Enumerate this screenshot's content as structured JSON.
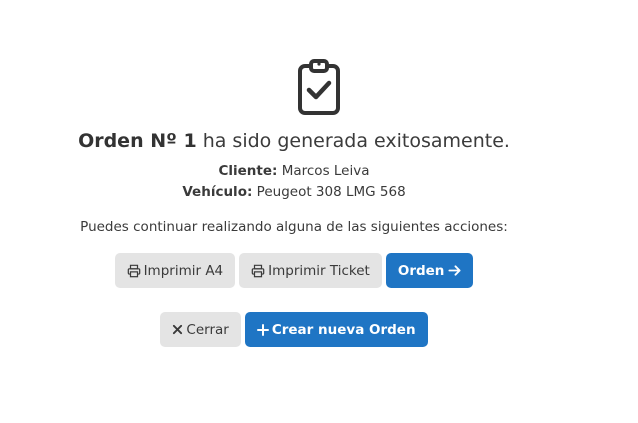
{
  "success": {
    "order_label": "Orden Nº 1",
    "message_rest": " ha sido generada exitosamente.",
    "client_label": "Cliente:",
    "client_value": " Marcos Leiva",
    "vehicle_label": "Vehículo:",
    "vehicle_value": " Peugeot 308 LMG 568",
    "hint": "Puedes continuar realizando alguna de las siguientes acciones:"
  },
  "actions": {
    "print_a4": "Imprimir A4",
    "print_ticket": "Imprimir Ticket",
    "order": "Orden",
    "close": "Cerrar",
    "new_order": "Crear nueva Orden"
  },
  "icons": {
    "main": "clipboard-check-icon",
    "print": "printer-icon",
    "arrow": "arrow-right-icon",
    "close": "x-icon",
    "plus": "plus-icon"
  },
  "colors": {
    "primary": "#1f75c4",
    "secondary": "#e4e4e4",
    "text": "#3a3a3a"
  }
}
